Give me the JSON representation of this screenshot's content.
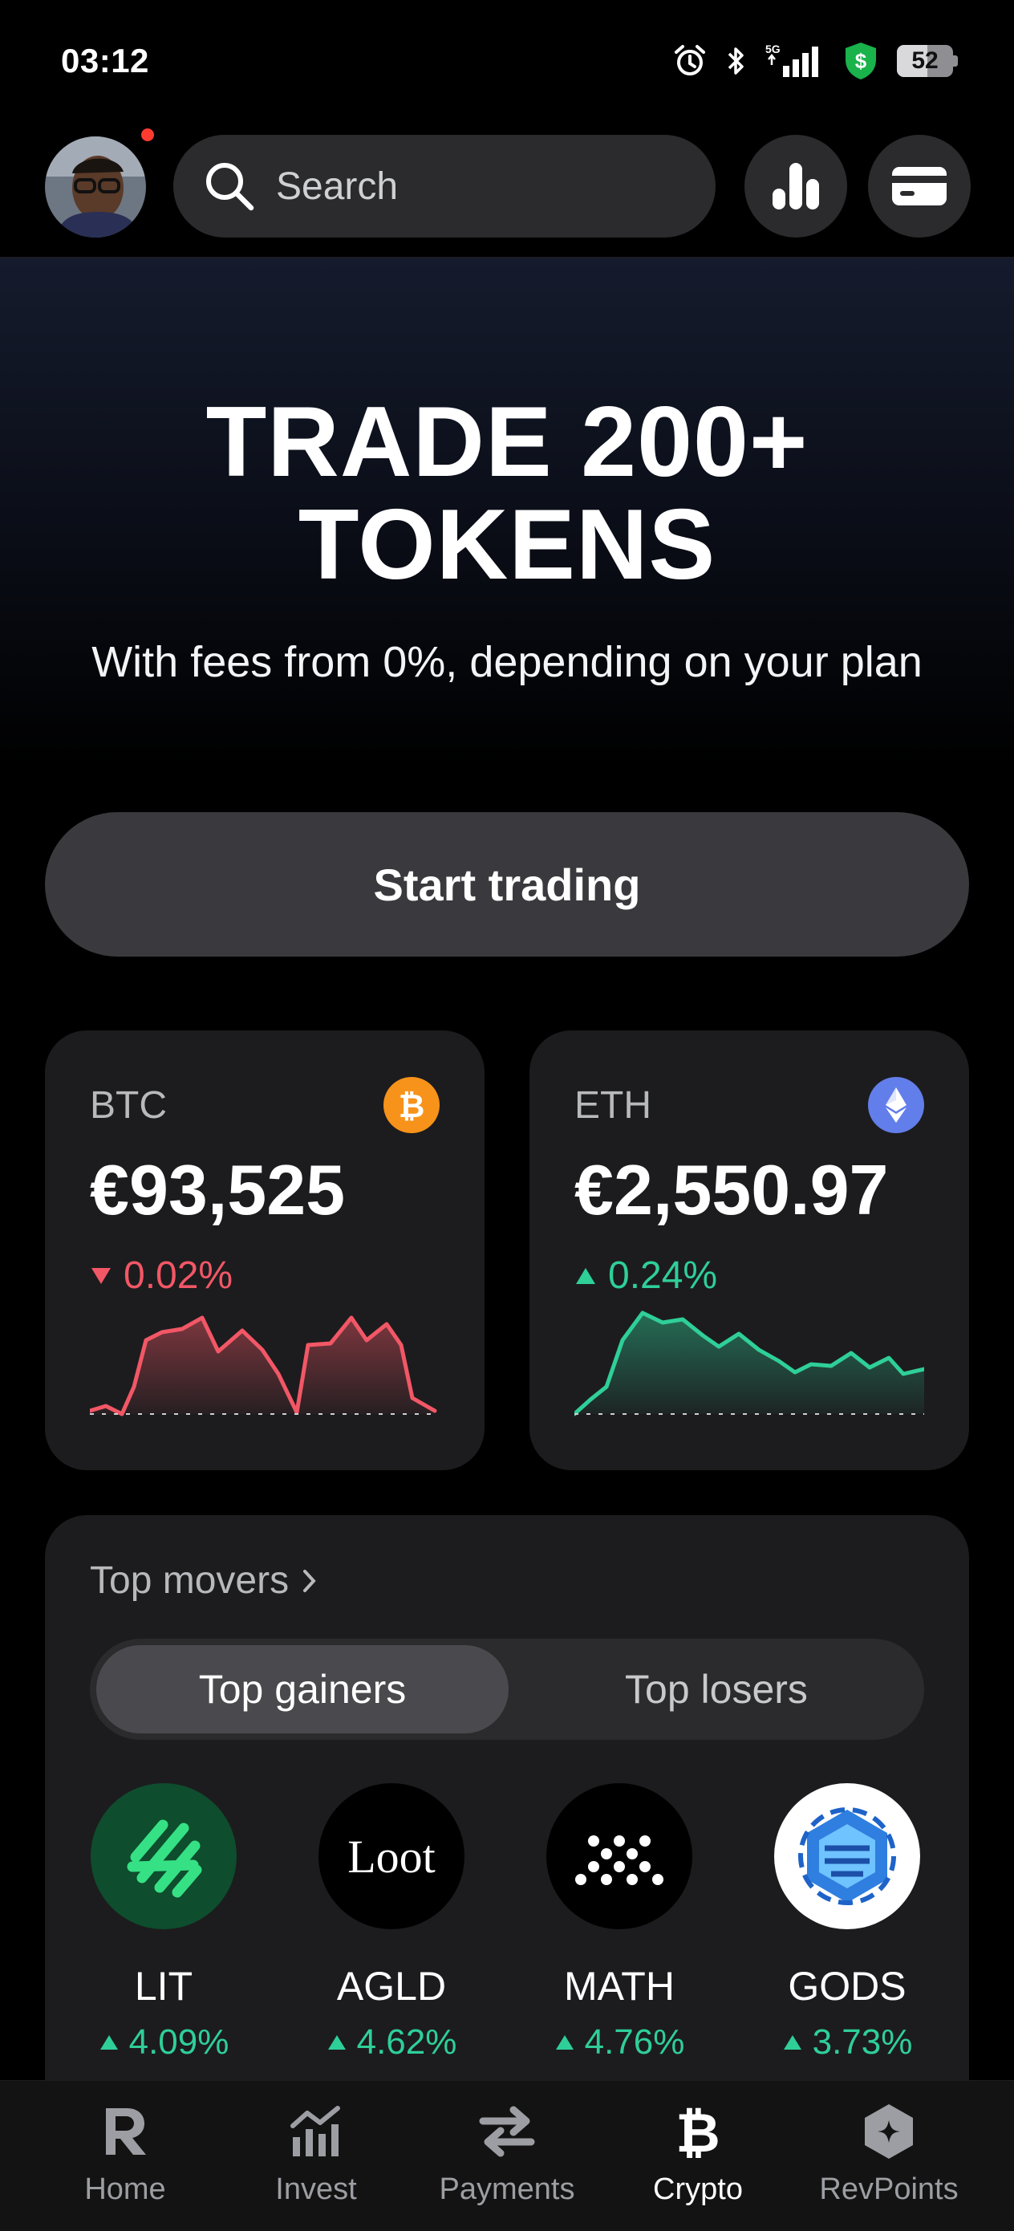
{
  "status_bar": {
    "time": "03:12",
    "network": "5G",
    "battery": "52"
  },
  "header": {
    "search_placeholder": "Search"
  },
  "hero": {
    "title_line1": "TRADE 200+",
    "title_line2": "TOKENS",
    "subtitle": "With fees from 0%, depending on your plan",
    "cta_label": "Start trading"
  },
  "coins": [
    {
      "symbol": "BTC",
      "price": "€93,525",
      "change": "0.02%",
      "direction": "down",
      "color": "#f25766",
      "logo_color": "#f7931a"
    },
    {
      "symbol": "ETH",
      "price": "€2,550.97",
      "change": "0.24%",
      "direction": "up",
      "color": "#2fcf98",
      "logo_color": "#627eea"
    }
  ],
  "movers": {
    "title": "Top movers",
    "tabs": [
      "Top gainers",
      "Top losers"
    ],
    "active_tab": "Top gainers",
    "items": [
      {
        "symbol": "LIT",
        "change": "4.09%"
      },
      {
        "symbol": "AGLD",
        "change": "4.62%",
        "logo_text": "Loot"
      },
      {
        "symbol": "MATH",
        "change": "4.76%"
      },
      {
        "symbol": "GODS",
        "change": "3.73%"
      }
    ]
  },
  "nav": {
    "items": [
      {
        "label": "Home",
        "icon": "revolut-r-icon"
      },
      {
        "label": "Invest",
        "icon": "invest-chart-icon"
      },
      {
        "label": "Payments",
        "icon": "transfer-arrows-icon"
      },
      {
        "label": "Crypto",
        "icon": "bitcoin-icon"
      },
      {
        "label": "RevPoints",
        "icon": "revpoints-hexagon-icon"
      }
    ],
    "active": "Crypto"
  }
}
